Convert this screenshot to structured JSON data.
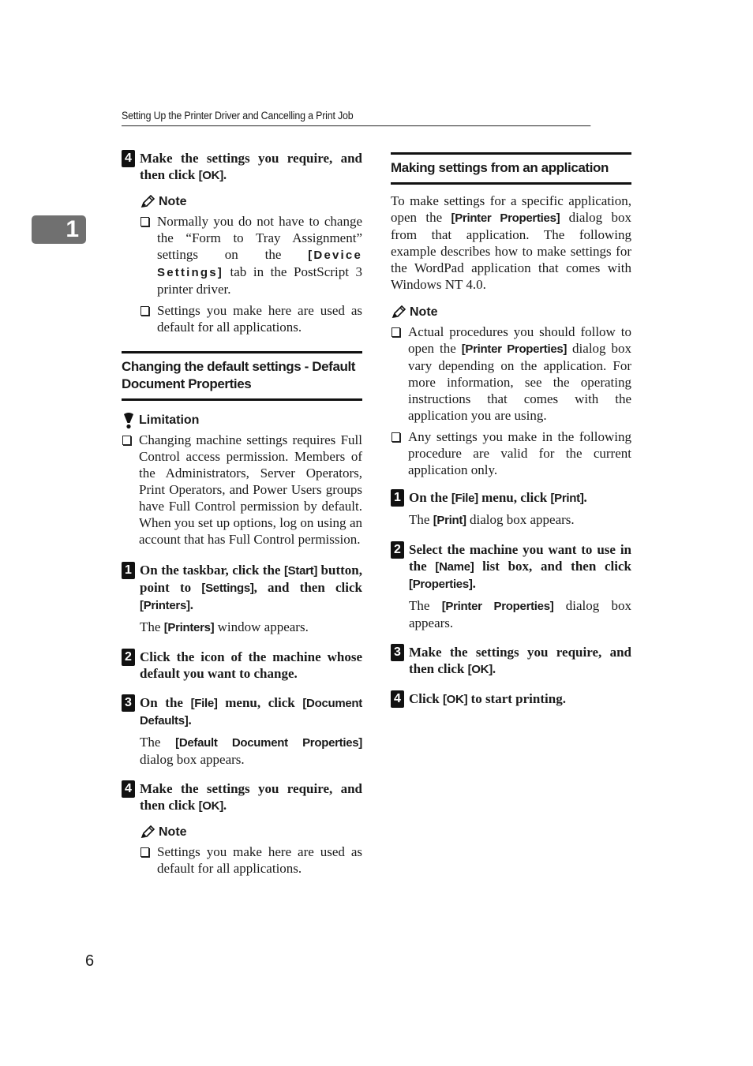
{
  "header": {
    "running_title": "Setting Up the Printer Driver and Cancelling a Print Job"
  },
  "chapter_tab": {
    "number": "1"
  },
  "page_number": "6",
  "left_column": {
    "top_step": {
      "number": "4",
      "text_before": "Make the settings you require, and then click ",
      "kw": "[OK]",
      "text_after": ".",
      "note": {
        "label": "Note",
        "items": [
          {
            "before": "Normally you do not have to change the “Form to Tray Assignment” settings on the ",
            "kw": "[Device Settings]",
            "after": " tab in the PostScript 3 printer driver."
          },
          {
            "before": "Settings you make here are used as default for all applications.",
            "kw": "",
            "after": ""
          }
        ]
      }
    },
    "section_title": "Changing the default settings - Default Document Properties",
    "limitation": {
      "label": "Limitation",
      "items": [
        "Changing machine settings requires Full Control access permission. Members of the Administrators, Server Operators, Print Operators, and Power Users groups have Full Control permission by default. When you set up options, log on using an account that has Full Control permission."
      ]
    },
    "steps": [
      {
        "number": "1",
        "parts": [
          [
            "t",
            "On the taskbar, click the "
          ],
          [
            "k",
            "[Start]"
          ],
          [
            "t",
            " button, point to "
          ],
          [
            "k",
            "[Settings]"
          ],
          [
            "t",
            ", and then click "
          ],
          [
            "k",
            "[Printers]"
          ],
          [
            "t",
            "."
          ]
        ],
        "result": [
          [
            "t",
            "The "
          ],
          [
            "k",
            "[Printers]"
          ],
          [
            "t",
            " window appears."
          ]
        ]
      },
      {
        "number": "2",
        "parts": [
          [
            "t",
            "Click the icon of the machine whose default you want to change."
          ]
        ],
        "result": null
      },
      {
        "number": "3",
        "parts": [
          [
            "t",
            "On the "
          ],
          [
            "k",
            "[File]"
          ],
          [
            "t",
            " menu, click "
          ],
          [
            "k",
            "[Document Defaults]"
          ],
          [
            "t",
            "."
          ]
        ],
        "result": [
          [
            "t",
            "The "
          ],
          [
            "k",
            "[Default Document Properties]"
          ],
          [
            "t",
            " dialog box appears."
          ]
        ]
      },
      {
        "number": "4",
        "parts": [
          [
            "t",
            "Make the settings you require, and then click "
          ],
          [
            "k",
            "[OK]"
          ],
          [
            "t",
            "."
          ]
        ],
        "result": null,
        "note": {
          "label": "Note",
          "items": [
            "Settings you make here are used as default for all applications."
          ]
        }
      }
    ]
  },
  "right_column": {
    "section_title": "Making settings from an application",
    "intro": [
      [
        "t",
        "To make settings for a specific application, open the "
      ],
      [
        "k",
        "[Printer Properties]"
      ],
      [
        "t",
        " dialog box from that application. The following example describes how to make settings for the WordPad application that comes with Windows NT 4.0."
      ]
    ],
    "note": {
      "label": "Note",
      "items": [
        [
          [
            "t",
            "Actual procedures you should follow to open the "
          ],
          [
            "k",
            "[Printer Properties]"
          ],
          [
            "t",
            " dialog box vary depending on the application. For more information, see the operating instructions that comes with the application you are using."
          ]
        ],
        [
          [
            "t",
            "Any settings you make in the following procedure are valid for the current application only."
          ]
        ]
      ]
    },
    "steps": [
      {
        "number": "1",
        "parts": [
          [
            "t",
            "On the "
          ],
          [
            "k",
            "[File]"
          ],
          [
            "t",
            " menu, click "
          ],
          [
            "k",
            "[Print]"
          ],
          [
            "t",
            "."
          ]
        ],
        "result": [
          [
            "t",
            "The "
          ],
          [
            "k",
            "[Print]"
          ],
          [
            "t",
            " dialog box appears."
          ]
        ]
      },
      {
        "number": "2",
        "parts": [
          [
            "t",
            "Select the machine you want to use in the "
          ],
          [
            "k",
            "[Name]"
          ],
          [
            "t",
            " list box, and then click "
          ],
          [
            "k",
            "[Properties]"
          ],
          [
            "t",
            "."
          ]
        ],
        "result": [
          [
            "t",
            "The "
          ],
          [
            "k",
            "[Printer Properties]"
          ],
          [
            "t",
            " dialog box appears."
          ]
        ]
      },
      {
        "number": "3",
        "parts": [
          [
            "t",
            "Make the settings you require, and then click "
          ],
          [
            "k",
            "[OK]"
          ],
          [
            "t",
            "."
          ]
        ],
        "result": null
      },
      {
        "number": "4",
        "parts": [
          [
            "t",
            "Click "
          ],
          [
            "k",
            "[OK]"
          ],
          [
            "t",
            " to start printing."
          ]
        ],
        "result": null
      }
    ]
  }
}
